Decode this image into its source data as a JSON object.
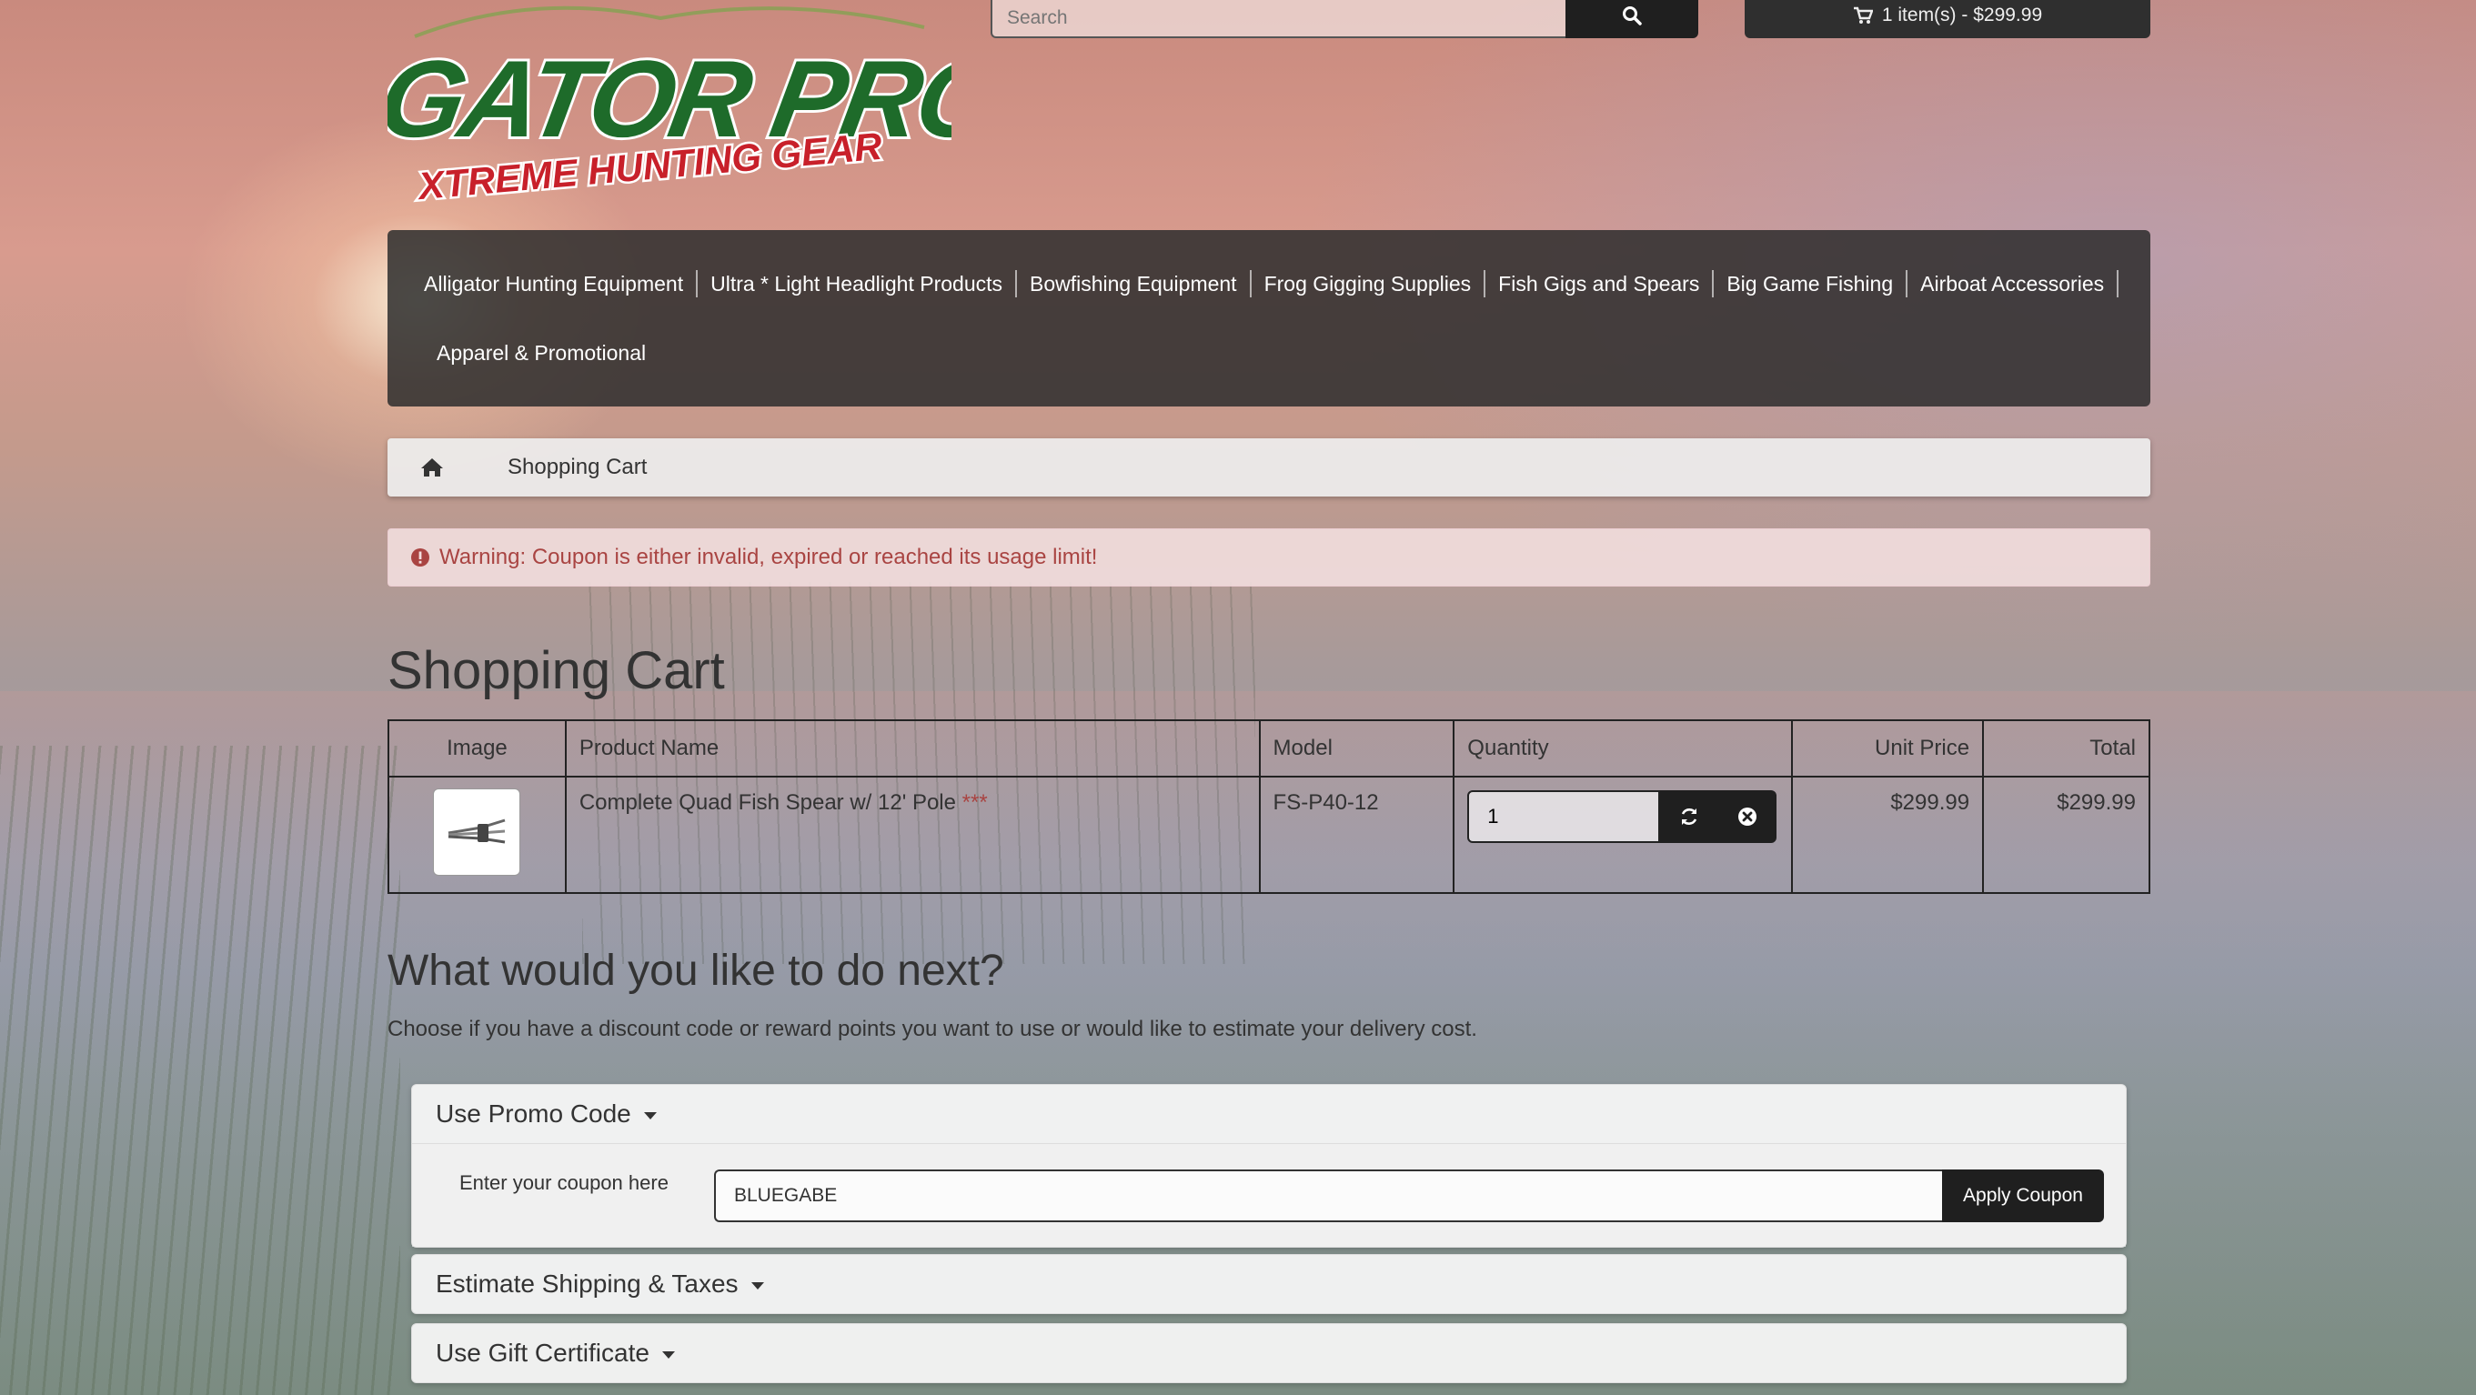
{
  "header": {
    "logo_text_main": "GATOR PRO",
    "logo_text_sub": "XTREME HUNTING GEAR",
    "search_placeholder": "Search",
    "cart_summary": "1 item(s) - $299.99"
  },
  "nav": {
    "items": [
      "Alligator Hunting Equipment",
      "Ultra * Light Headlight Products",
      "Bowfishing Equipment",
      "Frog Gigging Supplies",
      "Fish Gigs and Spears",
      "Big Game Fishing",
      "Airboat Accessories",
      "Apparel & Promotional"
    ]
  },
  "breadcrumb": {
    "current": "Shopping Cart"
  },
  "alert": {
    "message": "Warning: Coupon is either invalid, expired or reached its usage limit!"
  },
  "page_title": "Shopping Cart",
  "cart_table": {
    "headers": [
      "Image",
      "Product Name",
      "Model",
      "Quantity",
      "Unit Price",
      "Total"
    ],
    "rows": [
      {
        "product_name": "Complete Quad Fish Spear w/ 12' Pole",
        "stock_flag": "***",
        "model": "FS-P40-12",
        "quantity": "1",
        "unit_price": "$299.99",
        "total": "$299.99"
      }
    ]
  },
  "next_section": {
    "title": "What would you like to do next?",
    "description": "Choose if you have a discount code or reward points you want to use or would like to estimate your delivery cost."
  },
  "panels": {
    "promo": {
      "title": "Use Promo Code",
      "label": "Enter your coupon here",
      "value": "BLUEGABE",
      "button": "Apply Coupon"
    },
    "shipping": {
      "title": "Estimate Shipping & Taxes"
    },
    "gift": {
      "title": "Use Gift Certificate"
    }
  },
  "colors": {
    "nav_bg": "#2d2d2d",
    "alert_text": "#a94442",
    "button_dark": "#1f1f1f",
    "logo_green": "#1e6b2a",
    "logo_yellow": "#f2c81f",
    "logo_red": "#c8202a"
  },
  "icons": [
    "search-icon",
    "cart-icon",
    "home-icon",
    "warning-icon",
    "refresh-icon",
    "remove-icon",
    "caret-down-icon"
  ]
}
